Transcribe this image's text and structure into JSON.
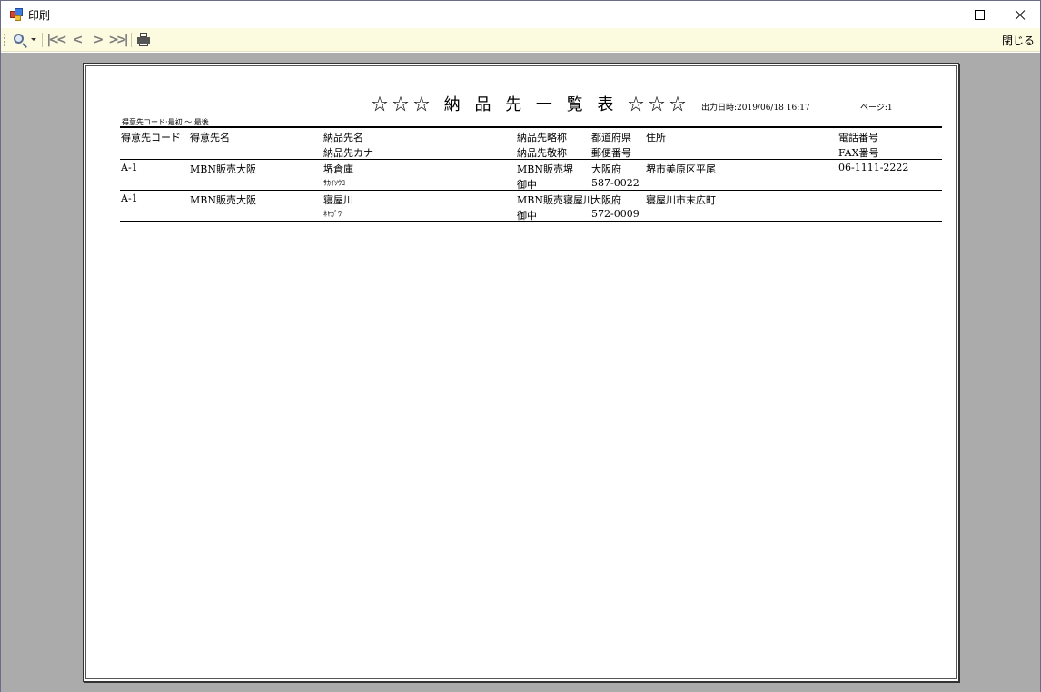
{
  "window": {
    "title": "印刷"
  },
  "toolbar": {
    "close_label": "閉じる",
    "icons": [
      "zoom-icon",
      "first-page-icon",
      "prev-page-icon",
      "next-page-icon",
      "last-page-icon",
      "printer-icon"
    ]
  },
  "report": {
    "title": "☆☆☆ 納 品 先 一 覧 表 ☆☆☆",
    "printed_at": "出力日時:2019/06/18 16:17",
    "page": "ページ:1",
    "range": "得意先コード:最初 ～ 最後",
    "headers": {
      "customer_code": "得意先コード",
      "customer_name": "得意先名",
      "dest_name": "納品先名",
      "dest_kana": "納品先カナ",
      "dest_abbr": "納品先略称",
      "dest_honorific": "納品先敬称",
      "prefecture": "都道府県",
      "postal": "郵便番号",
      "address": "住所",
      "phone": "電話番号",
      "fax": "FAX番号"
    },
    "rows": [
      {
        "customer_code": "A-1",
        "customer_name": "MBN販売大阪",
        "dest_name": "堺倉庫",
        "dest_kana": "ｻｶｲｿｳｺ",
        "dest_abbr": "MBN販売堺",
        "dest_honorific": "御中",
        "prefecture": "大阪府",
        "postal": "587-0022",
        "address": "堺市美原区平尾",
        "phone": "06-1111-2222"
      },
      {
        "customer_code": "A-1",
        "customer_name": "MBN販売大阪",
        "dest_name": "寝屋川",
        "dest_kana": "ﾈﾔｶﾞﾜ",
        "dest_abbr": "MBN販売寝屋川",
        "dest_honorific": "御中",
        "prefecture": "大阪府",
        "postal": "572-0009",
        "address": "寝屋川市末広町",
        "phone": ""
      }
    ]
  }
}
